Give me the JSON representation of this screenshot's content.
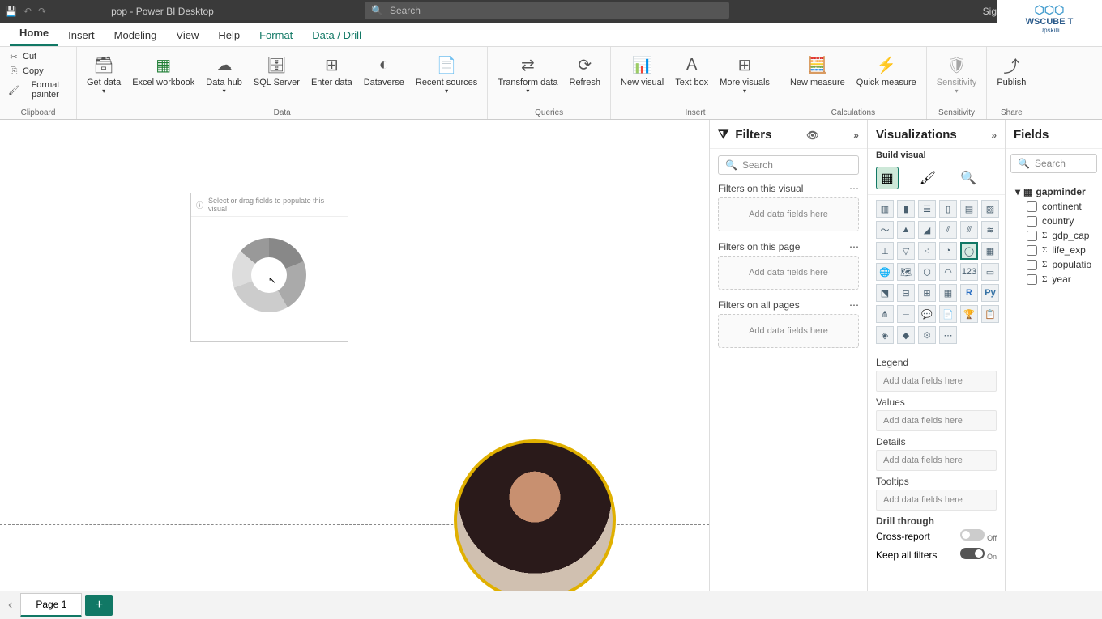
{
  "title": "pop - Power BI Desktop",
  "signin": "Sig",
  "logo_text": "WSCUBE T",
  "logo_sub": "Upskilli",
  "search_placeholder": "Search",
  "tabs": [
    "Home",
    "Insert",
    "Modeling",
    "View",
    "Help",
    "Format",
    "Data / Drill"
  ],
  "ribbon": {
    "clipboard": {
      "cut": "Cut",
      "copy": "Copy",
      "painter": "Format painter",
      "label": "Clipboard"
    },
    "data": {
      "get": "Get data",
      "excel": "Excel workbook",
      "hub": "Data hub",
      "sql": "SQL Server",
      "enter": "Enter data",
      "dataverse": "Dataverse",
      "recent": "Recent sources",
      "label": "Data"
    },
    "queries": {
      "transform": "Transform data",
      "refresh": "Refresh",
      "label": "Queries"
    },
    "insert": {
      "visual": "New visual",
      "text": "Text box",
      "more": "More visuals",
      "label": "Insert"
    },
    "calc": {
      "measure": "New measure",
      "quick": "Quick measure",
      "label": "Calculations"
    },
    "sens": {
      "btn": "Sensitivity",
      "label": "Sensitivity"
    },
    "share": {
      "publish": "Publish",
      "label": "Share"
    }
  },
  "visual_hint": "Select or drag fields to populate this visual",
  "filters": {
    "title": "Filters",
    "search": "Search",
    "on_visual": "Filters on this visual",
    "on_page": "Filters on this page",
    "on_all": "Filters on all pages",
    "drop": "Add data fields here"
  },
  "viz": {
    "title": "Visualizations",
    "subtitle": "Build visual",
    "wells": {
      "legend": "Legend",
      "values": "Values",
      "details": "Details",
      "tooltips": "Tooltips",
      "drop": "Add data fields here"
    },
    "drill": {
      "title": "Drill through",
      "cross": "Cross-report",
      "keep": "Keep all filters",
      "off": "Off",
      "on": "On"
    }
  },
  "fields": {
    "title": "Fields",
    "search": "Search",
    "table": "gapminder",
    "cols": [
      "continent",
      "country",
      "gdp_cap",
      "life_exp",
      "populatio",
      "year"
    ]
  },
  "page_tab": "Page 1"
}
